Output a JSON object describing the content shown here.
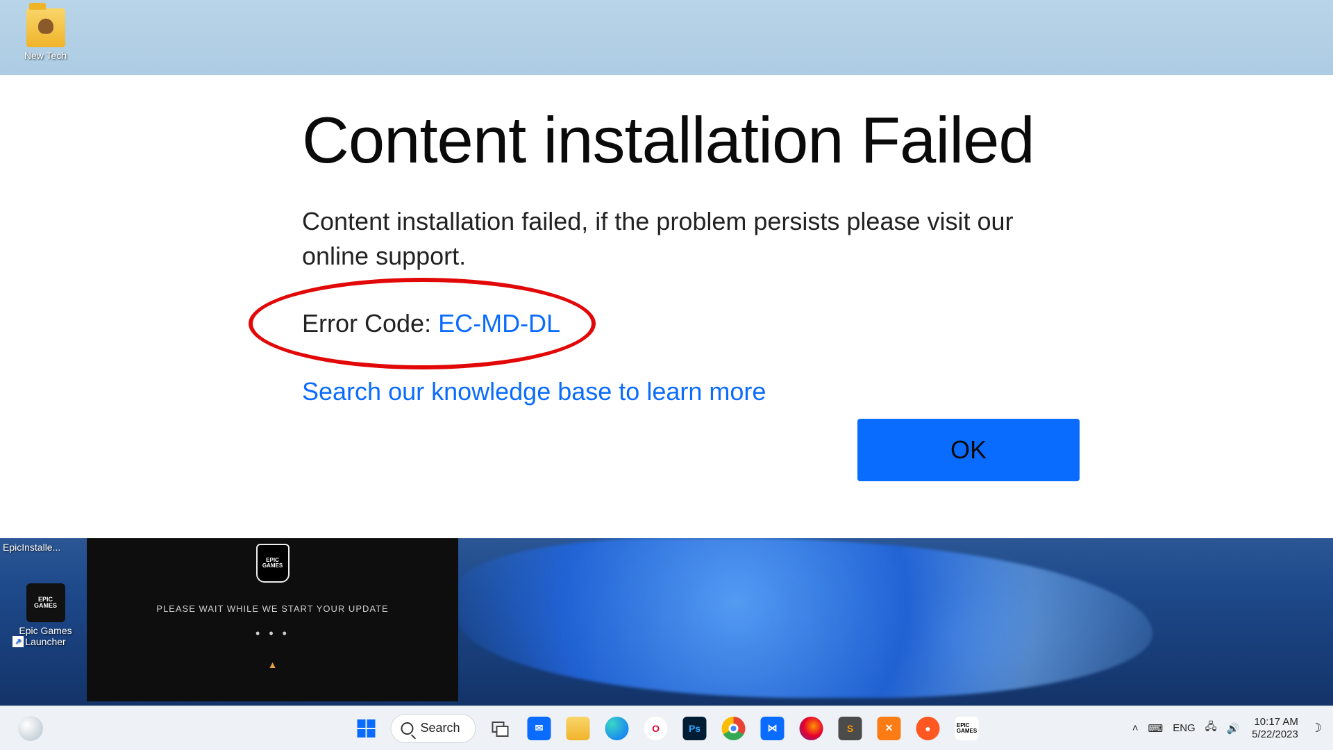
{
  "desktop": {
    "icons": [
      {
        "label": "New Tech"
      },
      {
        "label": "EpicInstalle..."
      },
      {
        "label": "Epic Games Launcher"
      }
    ]
  },
  "epic_splash": {
    "logo_top": "EPIC",
    "logo_bottom": "GAMES",
    "message": "PLEASE WAIT WHILE WE START YOUR UPDATE",
    "dots": "• • •",
    "warn_glyph": "▲"
  },
  "dialog": {
    "title": "Content installation Failed",
    "body": "Content installation failed, if the problem persists please visit our online support.",
    "error_label": "Error Code: ",
    "error_code": "EC-MD-DL",
    "kb_link": "Search our knowledge base to learn more",
    "ok": "OK"
  },
  "taskbar": {
    "search": "Search",
    "lang": "ENG",
    "time": "10:17 AM",
    "date": "5/22/2023"
  }
}
